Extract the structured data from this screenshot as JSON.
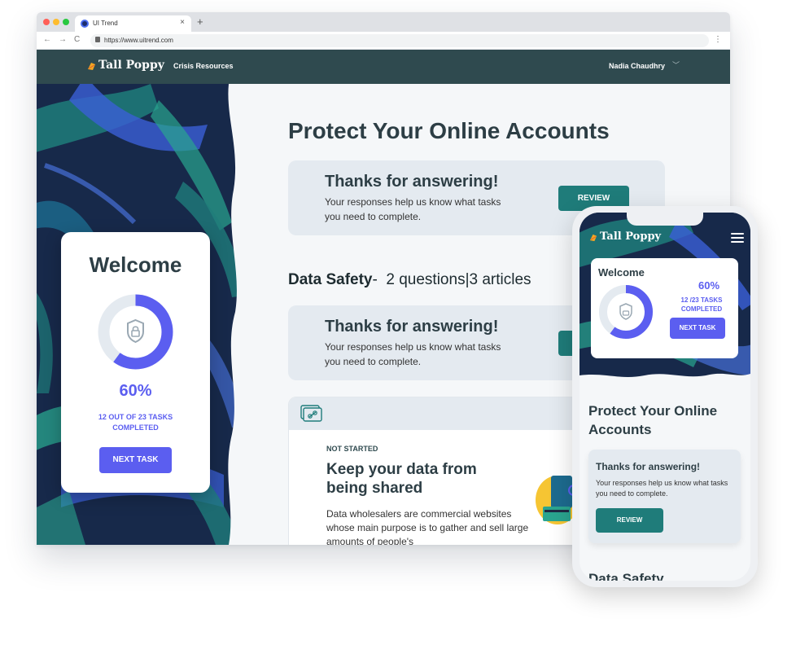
{
  "browser": {
    "tab_title": "UI Trend",
    "tab_close": "×",
    "tab_new": "+",
    "url": "https://www.uitrend.com",
    "nav_back": "←",
    "nav_forward": "→",
    "nav_reload": "C",
    "menu_glyph": "⋮"
  },
  "header": {
    "logo": "Tall Poppy",
    "nav_link": "Crisis Resources",
    "user_name": "Nadia Chaudhry",
    "user_chevron": "﹀"
  },
  "welcome_card": {
    "title": "Welcome",
    "progress_percent_label": "60%",
    "progress_fraction": 0.6,
    "tasks_text": "12 OUT OF 23 TASKS COMPLETED",
    "next_button": "NEXT TASK"
  },
  "main": {
    "title": "Protect Your Online Accounts",
    "card1": {
      "heading": "Thanks for answering!",
      "text": "Your responses help us know what tasks you need to complete.",
      "button": "REVIEW"
    },
    "section": {
      "name": "Data Safety",
      "separator": "-",
      "questions": "2 questions",
      "divider": "|",
      "articles": "3 articles"
    },
    "card2": {
      "heading": "Thanks for answering!",
      "text": "Your responses help us know what tasks you need to complete."
    },
    "article": {
      "status": "NOT STARTED",
      "heading": "Keep your data from being shared",
      "text": "Data wholesalers are commercial websites whose main purpose is to gather and sell large amounts of people's"
    }
  },
  "phone": {
    "logo": "Tall Poppy",
    "welcome": "Welcome",
    "progress_percent_label": "60%",
    "tasks_text": "12 /23 TASKS COMPLETED",
    "next_button": "NEXT TASK",
    "title": "Protect Your Online Accounts",
    "card_heading": "Thanks for answering!",
    "card_text": "Your responses help us know what tasks you need to complete.",
    "card_button": "REVIEW",
    "next_section_peek": "Data Safety"
  },
  "colors": {
    "header_bg": "#2f4a4f",
    "accent_purple": "#5b5ef0",
    "review_teal": "#1f7c7a",
    "jungle_dark": "#17294a",
    "card_bg": "#e4eaf0"
  }
}
